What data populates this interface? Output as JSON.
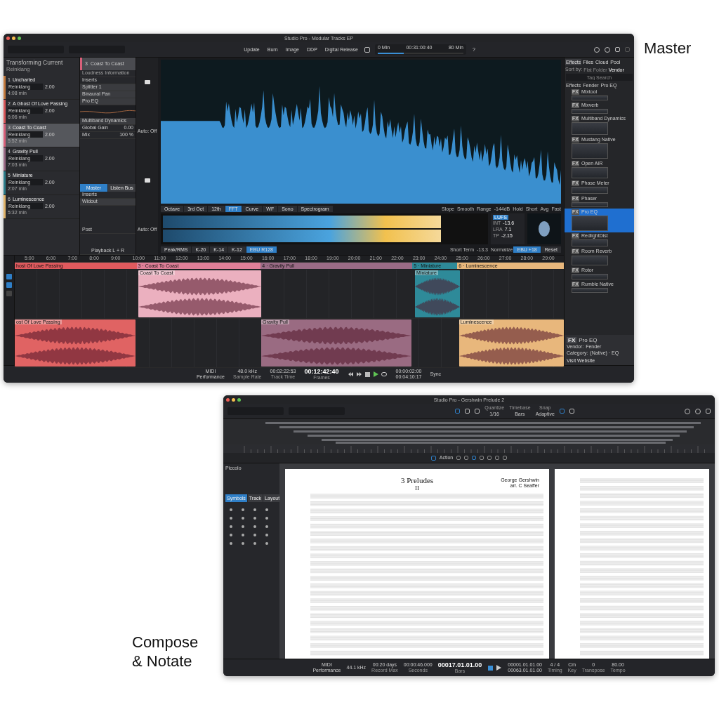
{
  "master": {
    "label": "Master",
    "title": "Studio Pro - Modular Tracks EP",
    "toolbar": {
      "buttons": [
        "Update",
        "Burn",
        "Image",
        "DDP",
        "Digital Release"
      ],
      "disc": {
        "start": "0 Min",
        "time": "00:31:00:40",
        "end": "80 Min",
        "level": 0.3
      },
      "help": "?"
    },
    "project": {
      "title": "Transforming Current",
      "subtitle": "Reinklang",
      "tracks": [
        {
          "number": "1",
          "name": "Uncharted",
          "device": "Reinklang",
          "value": "2.00",
          "duration": "4:08 min",
          "color": "#c47a3d",
          "selected": false
        },
        {
          "number": "2",
          "name": "A Ghost Of Love Passing",
          "device": "Reinklang",
          "value": "2.00",
          "duration": "6:06 min",
          "color": "#d9575a",
          "selected": false
        },
        {
          "number": "3",
          "name": "Coast To Coast",
          "device": "Reinklang",
          "value": "2.00",
          "duration": "5:52 min",
          "color": "#d9607a",
          "selected": true
        },
        {
          "number": "4",
          "name": "Gravity Pull",
          "device": "Reinklang",
          "value": "2.00",
          "duration": "7:03 min",
          "color": "#9a6b86",
          "selected": false
        },
        {
          "number": "5",
          "name": "Miniature",
          "device": "Reinklang",
          "value": "2.00",
          "duration": "2:07 min",
          "color": "#2e7f8c",
          "selected": false
        },
        {
          "number": "6",
          "name": "Luminescence",
          "device": "Reinklang",
          "value": "2.00",
          "duration": "5:32 min",
          "color": "#e0b36a",
          "selected": false
        }
      ]
    },
    "inspector": {
      "number": "3",
      "name": "Coast To Coast",
      "loudness": "Loudness Information",
      "inserts": "Inserts",
      "plugins": [
        "Splitter 1",
        "Binaural Pan",
        "Pro EQ"
      ],
      "multiband": "Multiband Dynamics",
      "params": [
        {
          "label": "Global Gain",
          "value": "0.00"
        },
        {
          "label": "Mix",
          "value": "100 %"
        }
      ],
      "auto": "Auto: Off",
      "bus_tabs": [
        {
          "label": "Master",
          "selected": true
        },
        {
          "label": "Listen Bus",
          "selected": false
        }
      ],
      "bus_inserts": "Inserts",
      "bus_plugins": [
        "Widout"
      ],
      "post": "Post",
      "auto2": "Auto: Off",
      "playback": "Playback L + R"
    },
    "analyzer": {
      "modes": [
        {
          "label": "Octave",
          "selected": false
        },
        {
          "label": "3rd Oct",
          "selected": false
        },
        {
          "label": "12th",
          "selected": false
        },
        {
          "label": "FFT",
          "selected": true
        },
        {
          "label": "Curve",
          "selected": false
        },
        {
          "label": "WF",
          "selected": false
        },
        {
          "label": "Sono",
          "selected": false
        },
        {
          "label": "Spectrogram",
          "selected": false
        }
      ],
      "controls": [
        "Slope",
        "Smooth",
        "Range",
        "-144dB",
        "Hold",
        "Short",
        "Avg",
        "Fast"
      ],
      "meter_modes": [
        {
          "label": "Peak/RMS",
          "selected": false
        },
        {
          "label": "K-20",
          "selected": false
        },
        {
          "label": "K-14",
          "selected": false
        },
        {
          "label": "K-12",
          "selected": false
        },
        {
          "label": "EBU R128",
          "selected": true
        }
      ],
      "meter": {
        "level": 0.86
      },
      "lufs": "LUFS",
      "readouts": [
        {
          "label": "INT",
          "value": "-13.6"
        },
        {
          "label": "LRA",
          "value": "7.1"
        },
        {
          "label": "TP",
          "value": "-2.15"
        }
      ],
      "short_term": "Short Term",
      "short_value": "-13.3",
      "normalize": "Normalize",
      "ebu": "EBU +18",
      "reset": "Reset"
    },
    "browser": {
      "tabs": [
        {
          "label": "Effects",
          "selected": true
        },
        {
          "label": "Files",
          "selected": false
        },
        {
          "label": "Cloud",
          "selected": false
        },
        {
          "label": "Pool",
          "selected": false
        }
      ],
      "sort_label": "Sort by:",
      "sort_options": [
        {
          "label": "Flat",
          "selected": false
        },
        {
          "label": "Folder",
          "selected": false
        },
        {
          "label": "Vendor",
          "selected": true
        }
      ],
      "search": {
        "placeholder": "Tag Search"
      },
      "breadcrumb": [
        "Effects",
        "Fender",
        "Pro EQ"
      ],
      "items": [
        {
          "badge": "FX",
          "name": "Mixtool",
          "selected": false
        },
        {
          "badge": "FX",
          "name": "Mixverb",
          "selected": false
        },
        {
          "badge": "FX",
          "name": "Multiband Dynamics",
          "selected": false
        },
        {
          "badge": "FX",
          "name": "Mustang Native",
          "selected": false
        },
        {
          "badge": "FX",
          "name": "Open AIR",
          "selected": false
        },
        {
          "badge": "FX",
          "name": "Phase Meter",
          "selected": false
        },
        {
          "badge": "FX",
          "name": "Phaser",
          "selected": false
        },
        {
          "badge": "FX",
          "name": "Pro EQ",
          "selected": true
        },
        {
          "badge": "FX",
          "name": "RedlightDist",
          "selected": false
        },
        {
          "badge": "FX",
          "name": "Room Reverb",
          "selected": false
        },
        {
          "badge": "FX",
          "name": "Rotor",
          "selected": false
        },
        {
          "badge": "FX",
          "name": "Rumble Native",
          "selected": false
        }
      ],
      "info": {
        "badge": "FX",
        "name": "Pro EQ",
        "vendor_label": "Vendor:",
        "vendor": "Fender",
        "category_label": "Category:",
        "category": "(Native) · EQ",
        "link": "Visit Website"
      }
    },
    "arrange": {
      "ruler": [
        "5:00",
        "6:00",
        "7:00",
        "8:00",
        "9:00",
        "10:00",
        "11:00",
        "12:00",
        "13:00",
        "14:00",
        "15:00",
        "16:00",
        "17:00",
        "18:00",
        "19:00",
        "20:00",
        "21:00",
        "22:00",
        "23:00",
        "24:00",
        "25:00",
        "26:00",
        "27:00",
        "28:00",
        "29:00"
      ],
      "markers": [
        {
          "label": "host Of Love Passing",
          "color": "#e05a5e"
        },
        {
          "label": "3 · Coast To Coast",
          "color": "#e07f98"
        },
        {
          "label": "4 · Gravity Pull",
          "color": "#9a6b86"
        },
        {
          "label": "5 · Miniature",
          "color": "#2e8a99"
        },
        {
          "label": "6 · Luminescence",
          "color": "#e8b77c"
        }
      ],
      "lanes": [
        [
          {
            "name": "Coast To Coast",
            "color": "#ebb0bf"
          },
          {
            "name": "Miniature",
            "color": "#2e8a99"
          }
        ],
        [
          {
            "name": "ost Of Love Passing",
            "color": "#e06363"
          },
          {
            "name": "Gravity Pull",
            "color": "#9a6b82"
          },
          {
            "name": "Luminescence",
            "color": "#e8b77c"
          }
        ]
      ]
    },
    "transport": {
      "midi": "MIDI",
      "performance": "Performance",
      "rate": "48.0 kHz",
      "rate_label": "Sample Rate",
      "track_time": "00:02:22:53",
      "track_time_label": "Track Time",
      "time": "00:12:42:40",
      "time_label": "Frames",
      "loop_start": "00:00:02:00",
      "loop_end": "00:04:10:17",
      "sync": "Sync"
    }
  },
  "compose": {
    "label": "Compose & Notate",
    "title": "Studio Pro - Gershwin Prelude 2",
    "toolbar": [
      {
        "label": "Quantize",
        "value": "1/16"
      },
      {
        "label": "Timebase",
        "value": "Bars"
      },
      {
        "label": "Snap",
        "value": "Adaptive"
      }
    ],
    "score_action": "Action",
    "panel": {
      "instrument": "Piccolo",
      "tabs": [
        {
          "label": "Symbols",
          "selected": true
        },
        {
          "label": "Track",
          "selected": false
        },
        {
          "label": "Layout",
          "selected": false
        }
      ]
    },
    "score": {
      "title": "3 Preludes",
      "number": "II",
      "composer": "George Gershwin",
      "arranger": "arr. C Seaffer"
    },
    "transport": {
      "midi": "MIDI",
      "performance": "Performance",
      "rate": "44.1 kHz",
      "record": "00:20 days",
      "record_label": "Record Max",
      "seconds": "00:00:46.000",
      "seconds_label": "Seconds",
      "time": "00017.01.01.00",
      "time_label": "Bars",
      "loop_start": "00001.01.01.00",
      "loop_end": "00063.01.01.00",
      "signature": "4 / 4",
      "signature_label": "Timing",
      "key": "Cm",
      "key_label": "Key",
      "transpose": "0",
      "transpose_label": "Transpose",
      "tempo": "80.00",
      "tempo_label": "Tempo"
    }
  }
}
